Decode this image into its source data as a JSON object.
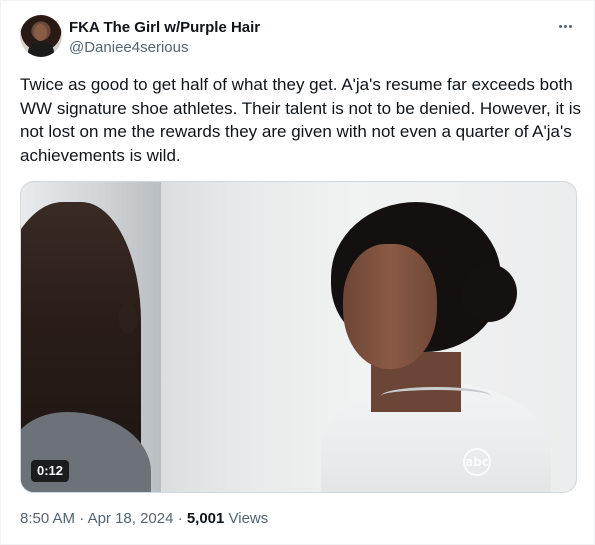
{
  "author": {
    "display_name": "FKA The Girl w/Purple Hair",
    "handle": "@Daniee4serious"
  },
  "more_icon": "more-horizontal-icon",
  "tweet": {
    "text": "Twice as good to get half of what they get. A'ja's resume far exceeds both WW signature shoe athletes. Their talent is not to be denied. However, it is not lost on me the rewards they are given with not even a quarter of A'ja's achievements is wild."
  },
  "media": {
    "duration": "0:12",
    "watermark": "abc"
  },
  "meta": {
    "time": "8:50 AM",
    "separator1": " · ",
    "date": "Apr 18, 2024",
    "separator2": " · ",
    "views_count": "5,001",
    "views_label": " Views"
  }
}
